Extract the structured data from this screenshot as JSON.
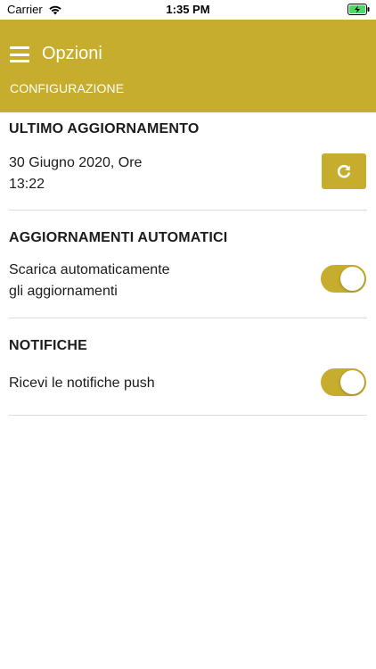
{
  "status_bar": {
    "carrier": "Carrier",
    "time": "1:35 PM"
  },
  "header": {
    "title": "Opzioni",
    "subtitle": "CONFIGURAZIONE"
  },
  "sections": {
    "last_update": {
      "title": "ULTIMO AGGIORNAMENTO",
      "line1": "30 Giugno 2020, Ore",
      "line2": "13:22"
    },
    "auto_updates": {
      "title": "AGGIORNAMENTI AUTOMATICI",
      "line1": "Scarica automaticamente",
      "line2": "gli aggiornamenti",
      "enabled": true
    },
    "notifications": {
      "title": "NOTIFICHE",
      "line1": "Ricevi le notifiche push",
      "enabled": true
    }
  },
  "colors": {
    "accent": "#c6ad2d",
    "divider": "#dcdcdc"
  },
  "icons": {
    "menu": "hamburger-menu-icon",
    "refresh": "refresh-icon",
    "wifi": "wifi-icon",
    "battery": "battery-charging-icon"
  }
}
